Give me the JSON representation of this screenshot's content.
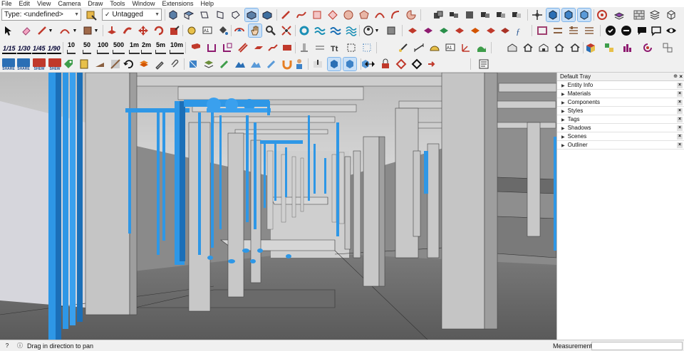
{
  "menu": [
    "File",
    "Edit",
    "View",
    "Camera",
    "Draw",
    "Tools",
    "Window",
    "Extensions",
    "Help"
  ],
  "type_select": {
    "value": "Type: <undefined>"
  },
  "tag_select": {
    "value": "Untagged"
  },
  "scales": [
    "1/15",
    "1/30",
    "1/45",
    "1/90"
  ],
  "dims": [
    "10",
    "50",
    "100",
    "500",
    "1m",
    "2m",
    "5m",
    "10m"
  ],
  "tray_buttons": [
    "SHARE",
    "SHARE",
    "SHEW",
    "SHEW"
  ],
  "tray": {
    "title": "Default Tray",
    "panels": [
      "Entity Info",
      "Materials",
      "Components",
      "Styles",
      "Tags",
      "Shadows",
      "Scenes",
      "Outliner"
    ]
  },
  "status": {
    "message": "Drag in direction to pan",
    "measurements_label": "Measurements"
  },
  "colors": {
    "pipe": "#2e97e6",
    "pipe_dark": "#1b6fb8",
    "concrete": "#c7c7c7",
    "floor": "#5e5e5e",
    "selection": "#c9e0f7"
  }
}
